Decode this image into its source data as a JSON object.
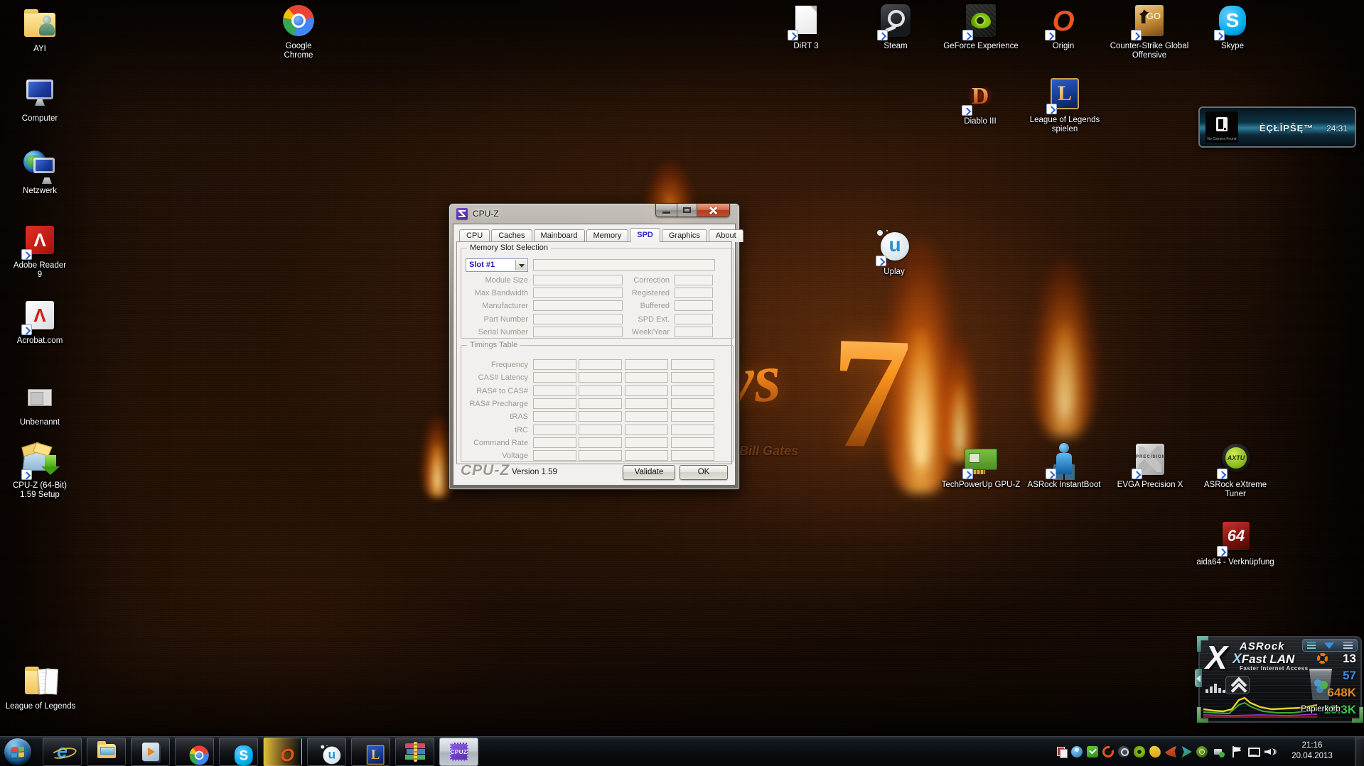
{
  "wallpaper": {
    "vs_text": "vs",
    "seven_text": "7",
    "caption": "Bill Gates"
  },
  "desktop_icons": {
    "ayi": "AYI",
    "computer": "Computer",
    "netzwerk": "Netzwerk",
    "adobe_reader": "Adobe Reader 9",
    "acrobat": "Acrobat.com",
    "unbenannt": "Unbenannt",
    "cpuz_setup": "CPU-Z (64-Bit) 1.59 Setup",
    "lol_folder": "League of Legends",
    "chrome": "Google Chrome",
    "dirt3": "DiRT 3",
    "steam": "Steam",
    "geforce": "GeForce Experience",
    "origin": "Origin",
    "csgo": "Counter-Strike Global Offensive",
    "skype": "Skype",
    "diablo": "Diablo III",
    "lol_spielen": "League of Legends spielen",
    "uplay": "Uplay",
    "gpuz": "TechPowerUp GPU-Z",
    "instantboot": "ASRock InstantBoot",
    "evga": "EVGA Precision X",
    "axtu": "ASRock eXtreme Tuner",
    "aida64": "aida64 - Verknüpfung",
    "papierkorb": "Papierkorb"
  },
  "eclipse_widget": {
    "title": "ÈÇŁĪPŠĘ™",
    "time": "24:31",
    "logo_caption": "No Camera Found"
  },
  "cpuz": {
    "window_title": "CPU-Z",
    "tabs": [
      "CPU",
      "Caches",
      "Mainboard",
      "Memory",
      "SPD",
      "Graphics",
      "About"
    ],
    "active_tab": "SPD",
    "memory_slot": {
      "group_title": "Memory Slot Selection",
      "slot_value": "Slot #1",
      "left_labels": [
        "Module Size",
        "Max Bandwidth",
        "Manufacturer",
        "Part Number",
        "Serial Number"
      ],
      "right_labels": [
        "Correction",
        "Registered",
        "Buffered",
        "SPD Ext.",
        "Week/Year"
      ]
    },
    "timings": {
      "group_title": "Timings Table",
      "row_labels": [
        "Frequency",
        "CAS# Latency",
        "RAS# to CAS#",
        "RAS# Precharge",
        "tRAS",
        "tRC",
        "Command Rate",
        "Voltage"
      ]
    },
    "footer": {
      "logo": "CPU-Z",
      "version": "Version 1.59",
      "validate_label": "Validate",
      "ok_label": "OK"
    }
  },
  "fastlan_widget": {
    "brand": "ASRock",
    "product_x": "X",
    "product": "Fast LAN",
    "tagline": "Faster Internet Access",
    "stats": [
      {
        "value": "13",
        "color": "#ffffff"
      },
      {
        "value": "57",
        "color": "#3f8fe0"
      },
      {
        "value": "648K",
        "color": "#e08820"
      },
      {
        "value": "15.3K",
        "color": "#35c93f"
      }
    ]
  },
  "taskbar": {
    "clock_time": "21:16",
    "clock_date": "20.04.2013",
    "items": [
      "start",
      "internet-explorer",
      "windows-explorer",
      "media-player",
      "chrome",
      "skype",
      "origin",
      "uplay",
      "league-of-legends",
      "winrar",
      "cpuz"
    ],
    "tray_icons": [
      "app-stack",
      "instantboot",
      "antivirus-check",
      "origin",
      "steam",
      "nvidia",
      "yellow-app",
      "horn-app",
      "play-app",
      "axtu",
      "usb-eject",
      "action-center-flag",
      "network",
      "volume"
    ]
  }
}
